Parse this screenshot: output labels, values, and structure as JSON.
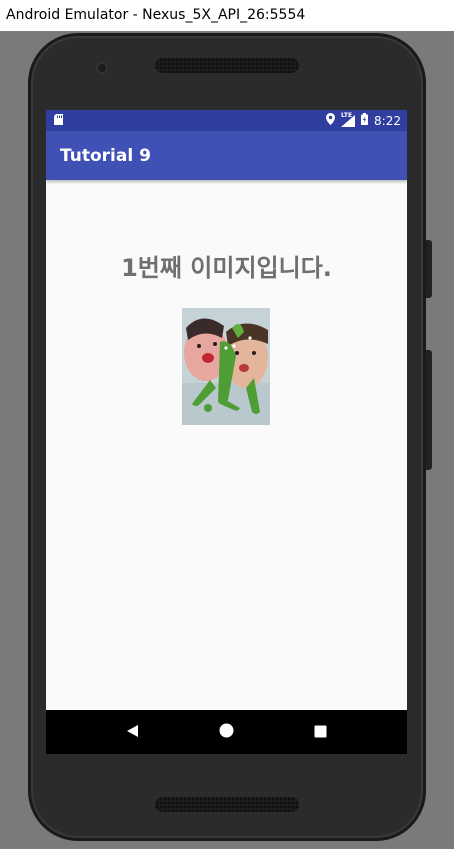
{
  "window": {
    "title": "Android Emulator - Nexus_5X_API_26:5554"
  },
  "status_bar": {
    "time": "8:22",
    "network_label": "LTE",
    "icons": [
      "sd-card-icon",
      "location-icon",
      "signal-icon",
      "battery-icon"
    ]
  },
  "app_bar": {
    "title": "Tutorial 9"
  },
  "main": {
    "headline": "1번째 이미지입니다.",
    "image": {
      "description_icon": "photo-image"
    }
  },
  "nav_bar": {
    "buttons": [
      "back-icon",
      "home-icon",
      "recents-icon"
    ]
  },
  "colors": {
    "primary": "#3f51b5",
    "primary_dark": "#303f9f",
    "headline_text": "#6f6f6f",
    "screen_bg": "#fafafa"
  }
}
